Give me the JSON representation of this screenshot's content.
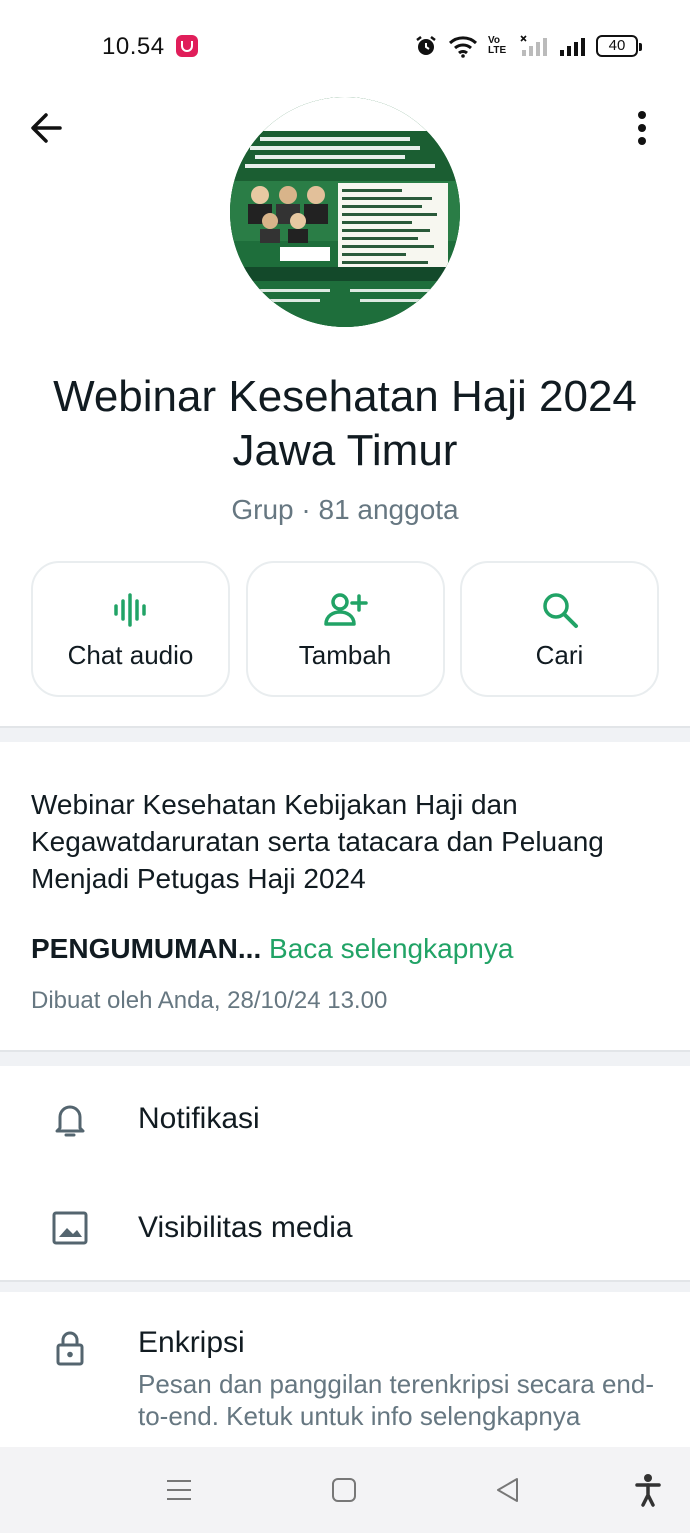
{
  "status_bar": {
    "time": "10.54",
    "battery": "40",
    "network_label": "Vo LTE"
  },
  "header": {
    "back_icon": "arrow-left-icon",
    "more_icon": "more-vertical-icon"
  },
  "group": {
    "title_line1": "Webinar Kesehatan Haji 2024",
    "title_line2": "Jawa Timur",
    "subtitle": "Grup · 81 anggota"
  },
  "actions": [
    {
      "label": "Chat audio",
      "icon": "audio-wave-icon"
    },
    {
      "label": "Tambah",
      "icon": "add-person-icon"
    },
    {
      "label": "Cari",
      "icon": "search-icon"
    }
  ],
  "description": {
    "text": "Webinar Kesehatan Kebijakan Haji dan Kegawatdaruratan serta tatacara dan Peluang Menjadi Petugas Haji 2024",
    "announcement_bold": "PENGUMUMAN...",
    "read_more": "Baca selengkapnya",
    "created_by": "Dibuat oleh Anda, 28/10/24 13.00"
  },
  "settings": {
    "notifications": {
      "label": "Notifikasi",
      "icon": "bell-icon"
    },
    "media_visibility": {
      "label": "Visibilitas media",
      "icon": "image-icon"
    },
    "encryption": {
      "label": "Enkripsi",
      "icon": "lock-icon",
      "description": "Pesan dan panggilan terenkripsi secara end-to-end. Ketuk untuk info selengkapnya"
    }
  },
  "colors": {
    "accent": "#21a366",
    "text_primary": "#111b21",
    "text_secondary": "#667781",
    "divider": "#f0f2f5"
  }
}
